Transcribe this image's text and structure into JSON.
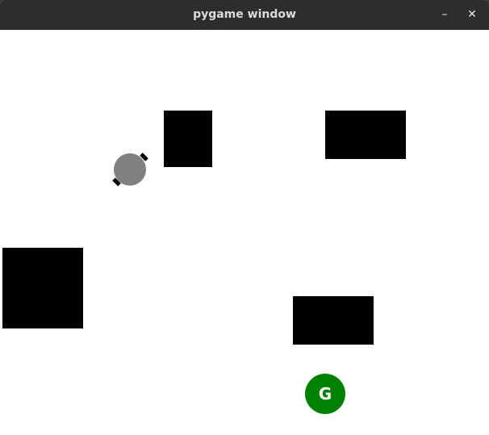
{
  "window": {
    "title": "pygame window",
    "minimize_glyph": "–",
    "close_glyph": "✕"
  },
  "colors": {
    "background": "#ffffff",
    "obstacle": "#000000",
    "robot_body": "#808080",
    "robot_wheels": "#000000",
    "goal": "#008000",
    "goal_text": "#ffffff"
  },
  "scene": {
    "obstacle_count": 4,
    "goal_label": "G"
  }
}
